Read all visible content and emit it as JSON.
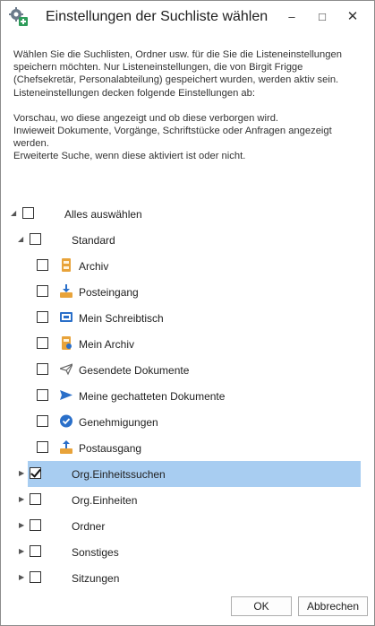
{
  "window": {
    "title": "Einstellungen der Suchliste wählen",
    "controls": {
      "minimize": "–",
      "maximize": "□",
      "close": "✕"
    }
  },
  "description": {
    "paragraph1": "Wählen Sie die Suchlisten, Ordner usw. für die Sie die Listeneinstellungen speichern möchten. Nur Listeneinstellungen, die von Birgit Frigge (Chefsekretär, Personalabteilung) gespeichert wurden, werden aktiv sein. Listeneinstellungen decken folgende Einstellungen ab:",
    "line1": "Vorschau, wo diese angezeigt und ob diese verborgen wird.",
    "line2": "Inwieweit Dokumente, Vorgänge, Schriftstücke oder Anfragen angezeigt werden.",
    "line3": "Erweiterte Suche, wenn diese aktiviert ist oder nicht."
  },
  "tree": {
    "select_all": {
      "label": "Alles auswählen",
      "checked": false,
      "expanded": true
    },
    "standard": {
      "label": "Standard",
      "checked": false,
      "expanded": true
    },
    "standard_items": [
      {
        "label": "Archiv",
        "icon": "archive-icon",
        "checked": false
      },
      {
        "label": "Posteingang",
        "icon": "inbox-icon",
        "checked": false
      },
      {
        "label": "Mein Schreibtisch",
        "icon": "desk-icon",
        "checked": false
      },
      {
        "label": "Mein Archiv",
        "icon": "my-archive-icon",
        "checked": false
      },
      {
        "label": "Gesendete Dokumente",
        "icon": "sent-icon",
        "checked": false
      },
      {
        "label": "Meine gechatteten Dokumente",
        "icon": "chat-send-icon",
        "checked": false
      },
      {
        "label": "Genehmigungen",
        "icon": "approval-icon",
        "checked": false
      },
      {
        "label": "Postausgang",
        "icon": "outbox-icon",
        "checked": false
      }
    ],
    "groups": [
      {
        "label": "Org.Einheitssuchen",
        "checked": true,
        "selected": true,
        "expanded": false
      },
      {
        "label": "Org.Einheiten",
        "checked": false,
        "selected": false,
        "expanded": false
      },
      {
        "label": "Ordner",
        "checked": false,
        "selected": false,
        "expanded": false
      },
      {
        "label": "Sonstiges",
        "checked": false,
        "selected": false,
        "expanded": false
      },
      {
        "label": "Sitzungen",
        "checked": false,
        "selected": false,
        "expanded": false
      }
    ]
  },
  "buttons": {
    "ok": "OK",
    "cancel": "Abbrechen"
  },
  "colors": {
    "selection": "#a8cdf1",
    "accent_blue": "#2a6fc9",
    "folder_orange": "#e8a33a"
  }
}
